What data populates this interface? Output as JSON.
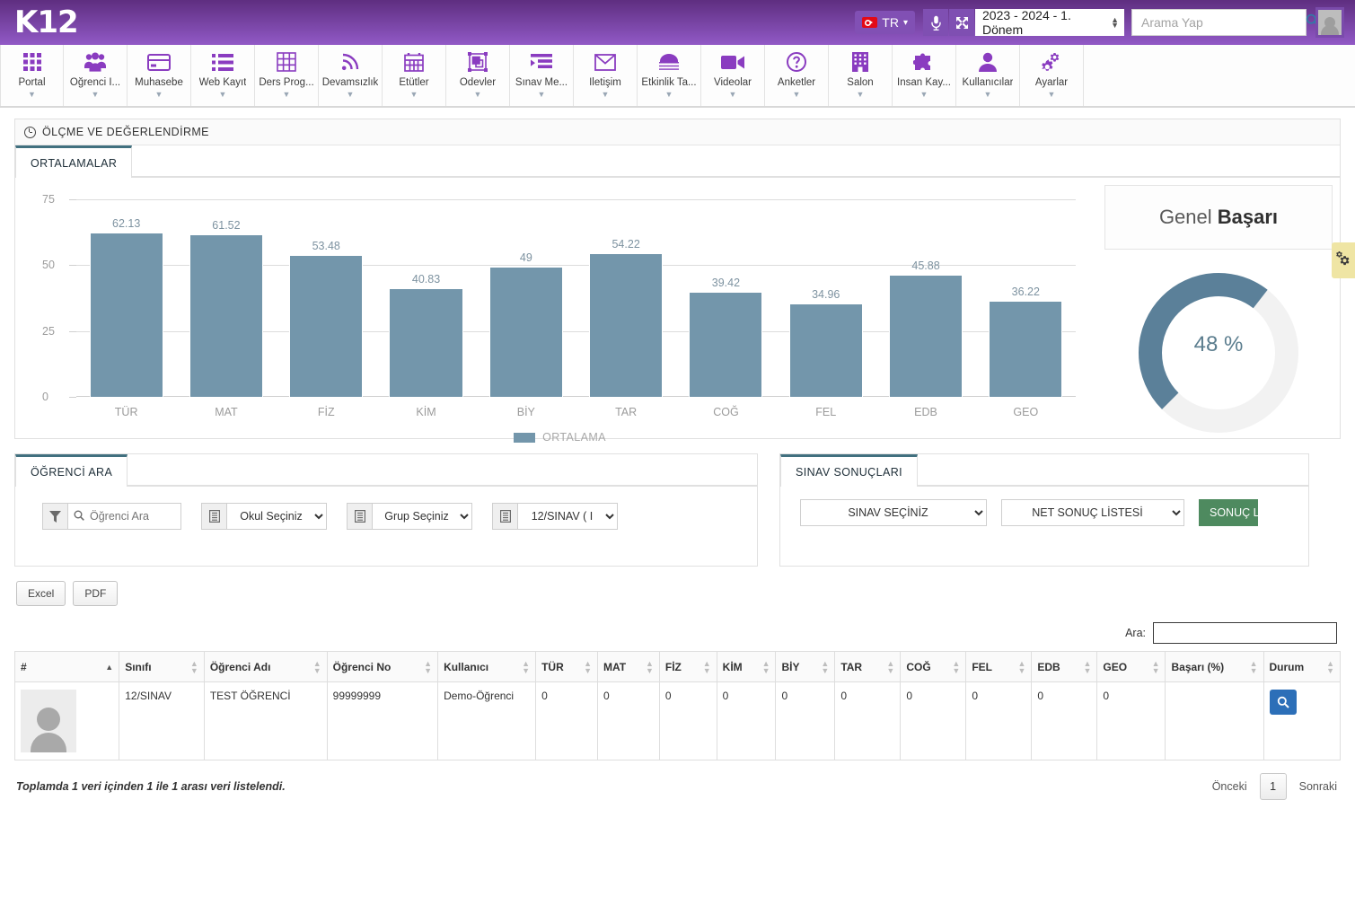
{
  "brand": {
    "logo": "K12"
  },
  "topbar": {
    "language": "TR",
    "mic_icon": "microphone-icon",
    "fullscreen_icon": "fullscreen-icon",
    "term_value": "2023 - 2024 - 1. Dönem",
    "search_placeholder": "Arama Yap",
    "search_value": "",
    "search_icon": "search-icon",
    "avatar": "user-avatar"
  },
  "nav": [
    {
      "label": "Portal",
      "icon": "grid-icon"
    },
    {
      "label": "Öğrenci İ...",
      "icon": "students-icon"
    },
    {
      "label": "Muhasebe",
      "icon": "card-icon"
    },
    {
      "label": "Web Kayıt",
      "icon": "list-icon"
    },
    {
      "label": "Ders Prog...",
      "icon": "table-icon"
    },
    {
      "label": "Devamsızlık",
      "icon": "rss-icon"
    },
    {
      "label": "Etütler",
      "icon": "calendar-icon"
    },
    {
      "label": "Ödevler",
      "icon": "shapes-icon"
    },
    {
      "label": "Sınav Me...",
      "icon": "indent-icon"
    },
    {
      "label": "İletişim",
      "icon": "envelope-icon"
    },
    {
      "label": "Etkinlik Ta...",
      "icon": "stadium-icon"
    },
    {
      "label": "Videolar",
      "icon": "video-icon"
    },
    {
      "label": "Anketler",
      "icon": "question-icon"
    },
    {
      "label": "Salon",
      "icon": "building-icon"
    },
    {
      "label": "İnsan Kay...",
      "icon": "puzzle-icon"
    },
    {
      "label": "Kullanıcılar",
      "icon": "user-icon"
    },
    {
      "label": "Ayarlar",
      "icon": "gears-icon"
    }
  ],
  "page_header": {
    "title": "ÖLÇME VE DEĞERLENDİRME",
    "icon": "clock-icon"
  },
  "chart_panel": {
    "tab": "ORTALAMALAR"
  },
  "chart_data": {
    "type": "bar",
    "title": "ORTALAMALAR",
    "categories": [
      "TÜR",
      "MAT",
      "FİZ",
      "KİM",
      "BİY",
      "TAR",
      "COĞ",
      "FEL",
      "EDB",
      "GEO"
    ],
    "values": [
      62.13,
      61.52,
      53.48,
      40.83,
      49,
      54.22,
      39.42,
      34.96,
      45.88,
      36.22
    ],
    "value_labels": [
      "62.13",
      "61.52",
      "53.48",
      "40.83",
      "49",
      "54.22",
      "39.42",
      "34.96",
      "45.88",
      "36.22"
    ],
    "series": [
      {
        "name": "ORTALAMA",
        "values": [
          62.13,
          61.52,
          53.48,
          40.83,
          49,
          54.22,
          39.42,
          34.96,
          45.88,
          36.22
        ]
      }
    ],
    "legend": [
      "ORTALAMA"
    ],
    "legend_position": "bottom",
    "yticks": [
      0,
      25,
      50,
      75
    ],
    "ylim": [
      0,
      75
    ],
    "xlabel": "",
    "ylabel": "",
    "grid": true,
    "bar_color": "#7396ab"
  },
  "gauge": {
    "title_light": "Genel ",
    "title_bold": "Başarı",
    "percent": 48,
    "percent_label": "48 %",
    "arc_color": "#5b8099",
    "track_color": "#f2f2f2"
  },
  "student_search": {
    "tab": "ÖĞRENCİ ARA",
    "filter_icon": "filter-icon",
    "search_placeholder": "Öğrenci Ara",
    "search_value": "",
    "search_icon": "search-icon",
    "school_select": "Okul Seçiniz",
    "group_select": "Grup Seçiniz",
    "class_select": "12/SINAV ( I",
    "list_icon": "list-select-icon"
  },
  "exam_results": {
    "tab": "SINAV SONUÇLARI",
    "exam_select": "SINAV SEÇİNİZ",
    "list_select": "NET SONUÇ LİSTESİ",
    "button": "SONUÇ Lİ"
  },
  "export": {
    "excel": "Excel",
    "pdf": "PDF"
  },
  "table_search": {
    "label": "Ara:",
    "value": ""
  },
  "table": {
    "columns": [
      "#",
      "Sınıfı",
      "Öğrenci Adı",
      "Öğrenci No",
      "Kullanıcı",
      "TÜR",
      "MAT",
      "FİZ",
      "KİM",
      "BİY",
      "TAR",
      "COĞ",
      "FEL",
      "EDB",
      "GEO",
      "Başarı (%)",
      "Durum"
    ],
    "rows": [
      {
        "photo": "student-photo-placeholder",
        "sinifi": "12/SINAV",
        "ogrenci_adi": "TEST ÖĞRENCİ",
        "ogrenci_no": "99999999",
        "kullanici": "Demo-Öğrenci",
        "TUR": "0",
        "MAT": "0",
        "FIZ": "0",
        "KIM": "0",
        "BIY": "0",
        "TAR": "0",
        "COG": "0",
        "FEL": "0",
        "EDB": "0",
        "GEO": "0",
        "basari": "",
        "durum_icon": "search-icon"
      }
    ]
  },
  "footer": {
    "summary": "Toplamda 1 veri içinden 1 ile 1 arası veri listelendi.",
    "prev": "Önceki",
    "page": "1",
    "next": "Sonraki"
  },
  "side_tab": {
    "icon": "gears-icon"
  }
}
